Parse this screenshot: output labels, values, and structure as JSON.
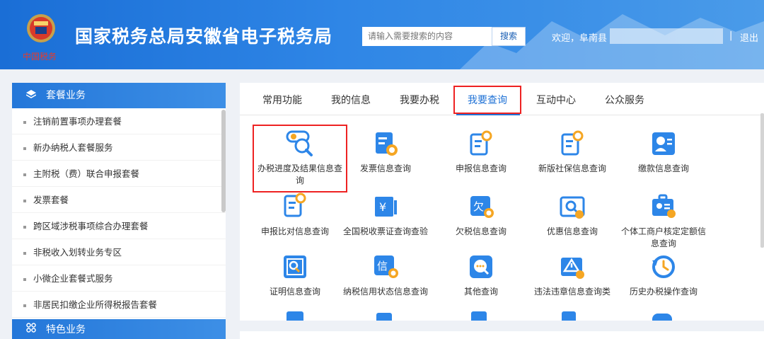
{
  "header": {
    "title": "国家税务总局安徽省电子税务局",
    "search_placeholder": "请输入需要搜索的内容",
    "search_button": "搜索",
    "welcome": "欢迎，阜南县",
    "separator": "|",
    "logout": "退出"
  },
  "sidebar": {
    "section1_title": "套餐业务",
    "items": [
      {
        "label": "注销前置事项办理套餐"
      },
      {
        "label": "新办纳税人套餐服务"
      },
      {
        "label": "主附税（费）联合申报套餐"
      },
      {
        "label": "发票套餐"
      },
      {
        "label": "跨区域涉税事项综合办理套餐"
      },
      {
        "label": "非税收入划转业务专区"
      },
      {
        "label": "小微企业套餐式服务"
      },
      {
        "label": "非居民扣缴企业所得税报告套餐"
      }
    ],
    "section2_title": "特色业务"
  },
  "main": {
    "tabs": [
      {
        "label": "常用功能"
      },
      {
        "label": "我的信息"
      },
      {
        "label": "我要办税"
      },
      {
        "label": "我要查询"
      },
      {
        "label": "互动中心"
      },
      {
        "label": "公众服务"
      }
    ],
    "active_tab": "我要查询",
    "tiles": [
      {
        "label": "办税进度及结果信息查询",
        "icon": "magnifier-progress-icon"
      },
      {
        "label": "发票信息查询",
        "icon": "invoice-search-icon"
      },
      {
        "label": "申报信息查询",
        "icon": "declaration-search-icon"
      },
      {
        "label": "新版社保信息查询",
        "icon": "social-security-search-icon"
      },
      {
        "label": "缴款信息查询",
        "icon": "payment-profile-icon"
      },
      {
        "label": "申报比对信息查询",
        "icon": "compare-search-icon"
      },
      {
        "label": "全国税收票证查询查验",
        "icon": "tax-certificate-icon"
      },
      {
        "label": "欠税信息查询",
        "icon": "owed-tax-icon"
      },
      {
        "label": "优惠信息查询",
        "icon": "discount-search-icon"
      },
      {
        "label": "个体工商户核定定额信息查询",
        "icon": "individual-business-icon"
      },
      {
        "label": "证明信息查询",
        "icon": "certificate-search-icon"
      },
      {
        "label": "纳税信用状态信息查询",
        "icon": "credit-status-icon"
      },
      {
        "label": "其他查询",
        "icon": "other-search-icon"
      },
      {
        "label": "违法违章信息查询类",
        "icon": "violation-search-icon"
      },
      {
        "label": "历史办税操作查询",
        "icon": "history-icon"
      }
    ]
  },
  "colors": {
    "header_blue": "#2f86e6",
    "accent_blue": "#2173d6",
    "highlight_red": "#e22222",
    "icon_blue": "#2d86e8",
    "icon_orange": "#f5a623"
  }
}
